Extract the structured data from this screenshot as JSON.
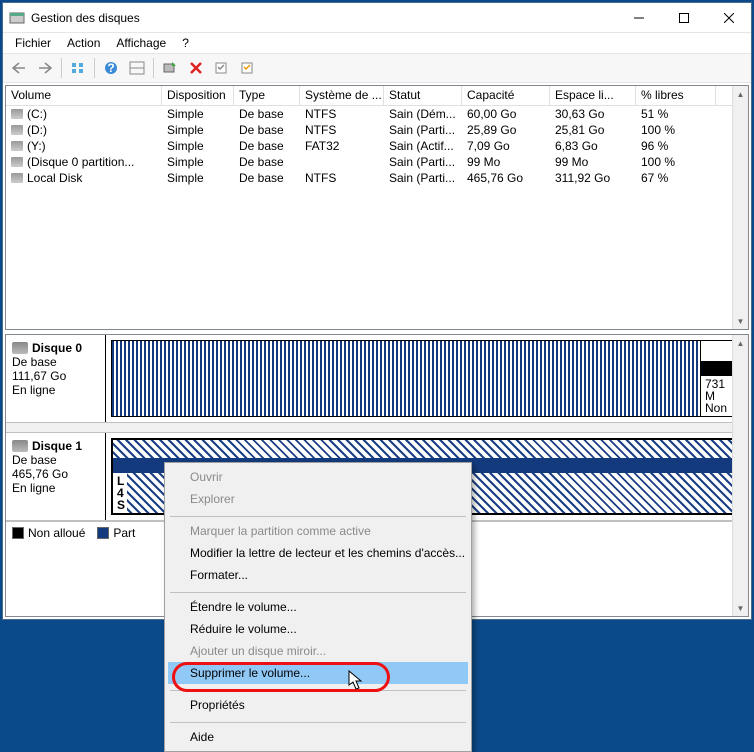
{
  "window": {
    "title": "Gestion des disques"
  },
  "menu": {
    "file": "Fichier",
    "action": "Action",
    "view": "Affichage",
    "help": "?"
  },
  "columns": {
    "volume": "Volume",
    "disposition": "Disposition",
    "type": "Type",
    "systeme": "Système de ...",
    "statut": "Statut",
    "capacite": "Capacité",
    "espace": "Espace li...",
    "libres": "% libres"
  },
  "rows": [
    {
      "vol": "(C:)",
      "disp": "Simple",
      "type": "De base",
      "fs": "NTFS",
      "stat": "Sain (Dém...",
      "cap": "60,00 Go",
      "free": "30,63 Go",
      "pct": "51 %"
    },
    {
      "vol": "(D:)",
      "disp": "Simple",
      "type": "De base",
      "fs": "NTFS",
      "stat": "Sain (Parti...",
      "cap": "25,89 Go",
      "free": "25,81 Go",
      "pct": "100 %"
    },
    {
      "vol": "(Y:)",
      "disp": "Simple",
      "type": "De base",
      "fs": "FAT32",
      "stat": "Sain (Actif...",
      "cap": "7,09 Go",
      "free": "6,83 Go",
      "pct": "96 %"
    },
    {
      "vol": "(Disque 0 partition...",
      "disp": "Simple",
      "type": "De base",
      "fs": "",
      "stat": "Sain (Parti...",
      "cap": "99 Mo",
      "free": "99 Mo",
      "pct": "100 %"
    },
    {
      "vol": "Local Disk",
      "disp": "Simple",
      "type": "De base",
      "fs": "NTFS",
      "stat": "Sain (Parti...",
      "cap": "465,76 Go",
      "free": "311,92 Go",
      "pct": "67 %"
    }
  ],
  "disks": [
    {
      "name": "Disque 0",
      "type": "De base",
      "size": "111,67 Go",
      "status": "En ligne",
      "tail": {
        "l1": "731 M",
        "l2": "Non"
      }
    },
    {
      "name": "Disque 1",
      "type": "De base",
      "size": "465,76 Go",
      "status": "En ligne",
      "partlabel": {
        "l1": "L",
        "l2": "4",
        "l3": "S"
      }
    }
  ],
  "legend": {
    "unalloc": "Non alloué",
    "primary": "Part"
  },
  "ctx": {
    "open": "Ouvrir",
    "explore": "Explorer",
    "mark": "Marquer la partition comme active",
    "letter": "Modifier la lettre de lecteur et les chemins d'accès...",
    "format": "Formater...",
    "extend": "Étendre le volume...",
    "shrink": "Réduire le volume...",
    "mirror": "Ajouter un disque miroir...",
    "delete": "Supprimer le volume...",
    "props": "Propriétés",
    "help": "Aide"
  }
}
